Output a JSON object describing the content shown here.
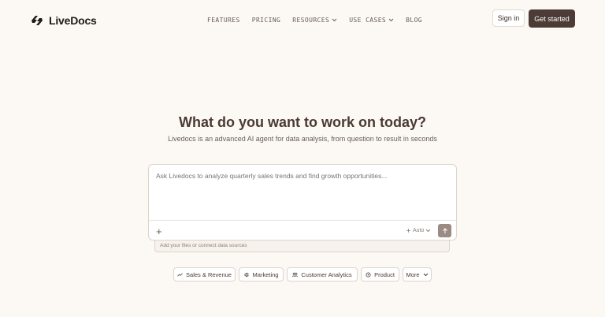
{
  "brand": {
    "name": "LiveDocs",
    "icon": "livedocs-logo-icon"
  },
  "nav": {
    "items": [
      {
        "label": "FEATURES",
        "dropdown": false
      },
      {
        "label": "PRICING",
        "dropdown": false
      },
      {
        "label": "RESOURCES",
        "dropdown": true
      },
      {
        "label": "USE CASES",
        "dropdown": true
      },
      {
        "label": "BLOG",
        "dropdown": false
      }
    ],
    "signin_label": "Sign in",
    "get_started_label": "Get started"
  },
  "hero": {
    "title": "What do you want to work on today?",
    "subtitle": "Livedocs is an advanced AI agent for data analysis, from question to result in seconds"
  },
  "composer": {
    "placeholder": "Ask Livedocs to analyze quarterly sales trends and find growth opportunities...",
    "add_icon": "plus-icon",
    "mode_label": "Auto",
    "send_icon": "arrow-up-icon",
    "hint": "Add your files or connect data sources"
  },
  "chips": [
    {
      "label": "Sales & Revenue",
      "icon": "trending-up-icon"
    },
    {
      "label": "Marketing",
      "icon": "megaphone-icon"
    },
    {
      "label": "Customer Analytics",
      "icon": "users-icon"
    },
    {
      "label": "Product",
      "icon": "box-icon"
    },
    {
      "label": "More",
      "icon": "chevron-down-icon"
    }
  ],
  "colors": {
    "background": "#fcf8f4",
    "primary_button": "#4c3b36",
    "send_button": "#9c8a85",
    "text": "#3d2f28"
  }
}
